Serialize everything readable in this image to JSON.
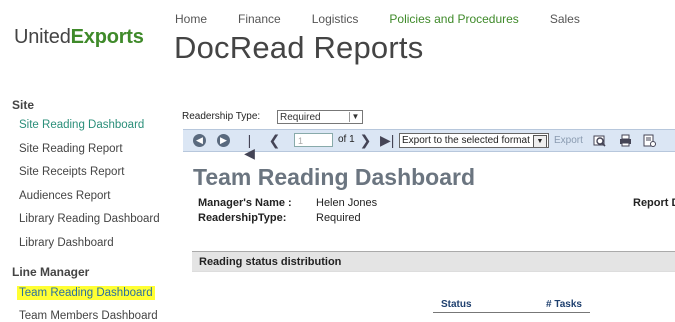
{
  "brand": {
    "name_regular": "United",
    "name_bold": "Exports"
  },
  "topnav": {
    "items": [
      {
        "label": "Home"
      },
      {
        "label": "Finance"
      },
      {
        "label": "Logistics"
      },
      {
        "label": "Policies and Procedures"
      },
      {
        "label": "Sales"
      }
    ],
    "active_color": "#3f8a2a"
  },
  "page": {
    "title": "DocRead Reports"
  },
  "sidebar": {
    "site_heading": "Site",
    "site_items": [
      {
        "label": "Site Reading Dashboard"
      },
      {
        "label": "Site Reading Report"
      },
      {
        "label": "Site Receipts Report"
      },
      {
        "label": "Audiences Report"
      },
      {
        "label": "Library Reading Dashboard"
      },
      {
        "label": "Library Dashboard"
      }
    ],
    "manager_heading": "Line Manager",
    "manager_items": [
      {
        "label": "Team Reading Dashboard"
      },
      {
        "label": "Team Members Dashboard"
      }
    ],
    "highlight_color": "#ffff33"
  },
  "filters": {
    "readership_label": "Readership Type:",
    "readership_value": "Required"
  },
  "toolbar": {
    "page_value": "1",
    "page_of": "of 1",
    "export_format": "Export to the selected format",
    "export_label": "Export",
    "icons": [
      "back-circle-icon",
      "forward-circle-icon",
      "first-page-icon",
      "prev-page-icon",
      "next-page-icon",
      "last-page-icon",
      "zoom-icon",
      "print-icon",
      "email-icon"
    ]
  },
  "report": {
    "title": "Team Reading Dashboard",
    "manager_label": "Manager's Name :",
    "manager_value": "Helen Jones",
    "readership_label": "ReadershipType:",
    "readership_value": "Required",
    "report_date_label": "Report D",
    "section_title": "Reading status distribution",
    "columns": [
      "Status",
      "# Tasks"
    ]
  }
}
